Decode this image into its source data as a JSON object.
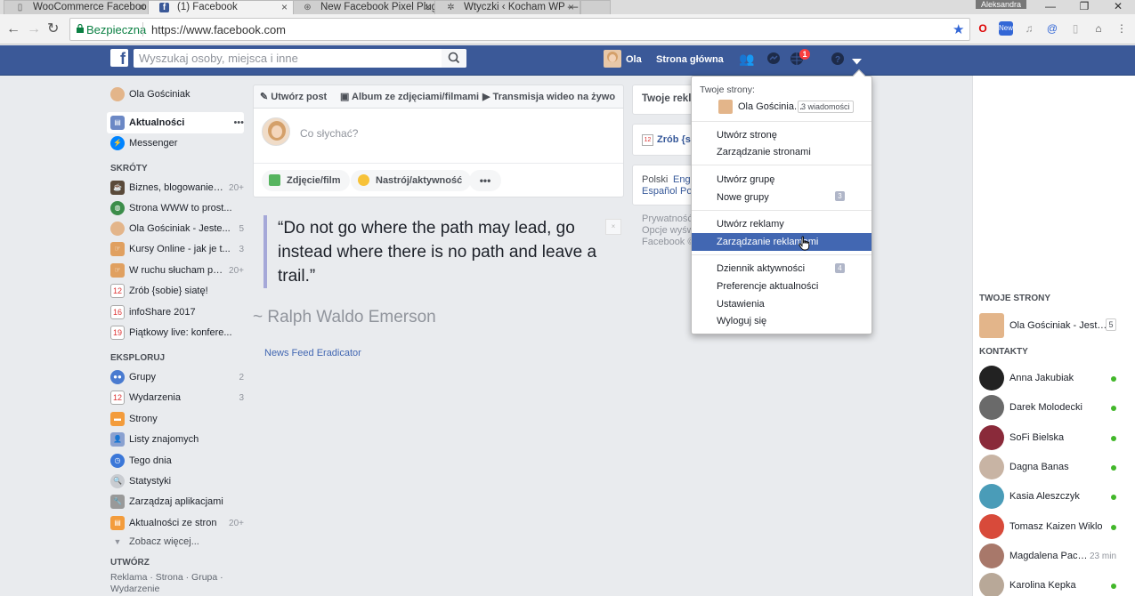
{
  "browser": {
    "tabs": [
      {
        "title": "WooCommerce Faceboo",
        "active": false
      },
      {
        "title": "(1) Facebook",
        "active": true
      },
      {
        "title": "New Facebook Pixel Plug",
        "active": false
      },
      {
        "title": "Wtyczki ‹ Kocham WP —",
        "active": false
      }
    ],
    "user_badge": "Aleksandra",
    "secure_label": "Bezpieczna",
    "url": "https://www.facebook.com"
  },
  "fb_header": {
    "search_placeholder": "Wyszukaj osoby, miejsca i inne",
    "user_name": "Ola",
    "home_label": "Strona główna",
    "notification_count": "1"
  },
  "left_nav": {
    "profile_name": "Ola Gościniak",
    "news_feed": "Aktualności",
    "news_feed_more": "•••",
    "messenger": "Messenger",
    "shortcuts_header": "SKRÓTY",
    "shortcuts": [
      {
        "label": "Biznes, blogowanie i ...",
        "count": "20+"
      },
      {
        "label": "Strona WWW to prost...",
        "count": ""
      },
      {
        "label": "Ola Gościniak - Jeste...",
        "count": "5"
      },
      {
        "label": "Kursy Online - jak je t...",
        "count": "3"
      },
      {
        "label": "W ruchu słucham pod...",
        "count": "20+"
      },
      {
        "label": "Zrób {sobie} siatę!",
        "count": ""
      },
      {
        "label": "infoShare 2017",
        "count": ""
      },
      {
        "label": "Piątkowy live: konfere...",
        "count": ""
      }
    ],
    "explore_header": "EKSPLORUJ",
    "explore": [
      {
        "label": "Grupy",
        "count": "2"
      },
      {
        "label": "Wydarzenia",
        "count": "3"
      },
      {
        "label": "Strony",
        "count": ""
      },
      {
        "label": "Listy znajomych",
        "count": ""
      },
      {
        "label": "Tego dnia",
        "count": ""
      },
      {
        "label": "Statystyki",
        "count": ""
      },
      {
        "label": "Zarządzaj aplikacjami",
        "count": ""
      },
      {
        "label": "Aktualności ze stron",
        "count": "20+"
      }
    ],
    "see_more": "Zobacz więcej...",
    "create_header": "UTWÓRZ",
    "create_links_1": "Reklama · Strona · Grupa ·",
    "create_links_2": "Wydarzenie"
  },
  "composer": {
    "tab_post": "Utwórz post",
    "tab_album": "Album ze zdjęciami/filmami",
    "tab_live": "Transmisja wideo na żywo",
    "placeholder": "Co słychać?",
    "photo_btn": "Zdjęcie/film",
    "feeling_btn": "Nastrój/aktywność",
    "more_btn": "•••"
  },
  "quote": {
    "text": "“Do not go where the path may lead, go instead where there is no path and leave a trail.”",
    "author": "~ Ralph Waldo Emerson",
    "plugin": "News Feed Eradicator"
  },
  "middle_right": {
    "your_ads": "Twoje rekla",
    "event": "Zrób {so",
    "lang_1a": "Polski",
    "lang_1b": "Engl",
    "lang_2a": "Español",
    "lang_2b": "Po",
    "footer_1": "Prywatność",
    "footer_2": "Opcje wyśw",
    "footer_3": "Facebook ©"
  },
  "dropdown": {
    "section_title": "Twoje strony:",
    "page_name": "Ola Gościnia...",
    "page_msgs": "3 wiadomości",
    "items": [
      {
        "label": "Utwórz stronę"
      },
      {
        "label": "Zarządzanie stronami"
      },
      {
        "label": "Utwórz grupę"
      },
      {
        "label": "Nowe grupy",
        "badge": "3"
      },
      {
        "label": "Utwórz reklamy"
      },
      {
        "label": "Zarządzanie reklamami"
      },
      {
        "label": "Dziennik aktywności",
        "badge": "4"
      },
      {
        "label": "Preferencje aktualności"
      },
      {
        "label": "Ustawienia"
      },
      {
        "label": "Wyloguj się"
      }
    ]
  },
  "right_sidebar": {
    "pages_header": "TWOJE STRONY",
    "page_name": "Ola Gościniak - Jeste...",
    "page_count": "5",
    "contacts_header": "KONTAKTY",
    "contacts": [
      {
        "name": "Anna Jakubiak",
        "time": ""
      },
      {
        "name": "Darek Molodecki",
        "time": ""
      },
      {
        "name": "SoFi Bielska",
        "time": ""
      },
      {
        "name": "Dagna Banas",
        "time": ""
      },
      {
        "name": "Kasia Aleszczyk",
        "time": ""
      },
      {
        "name": "Tomasz Kaizen Wiklo",
        "time": ""
      },
      {
        "name": "Magdalena Pacior...",
        "time": "23 min"
      },
      {
        "name": "Karolina Kepka",
        "time": ""
      }
    ]
  },
  "colors": {
    "fb_blue": "#3b5998",
    "highlight": "#4267b2",
    "online": "#42b72a"
  }
}
